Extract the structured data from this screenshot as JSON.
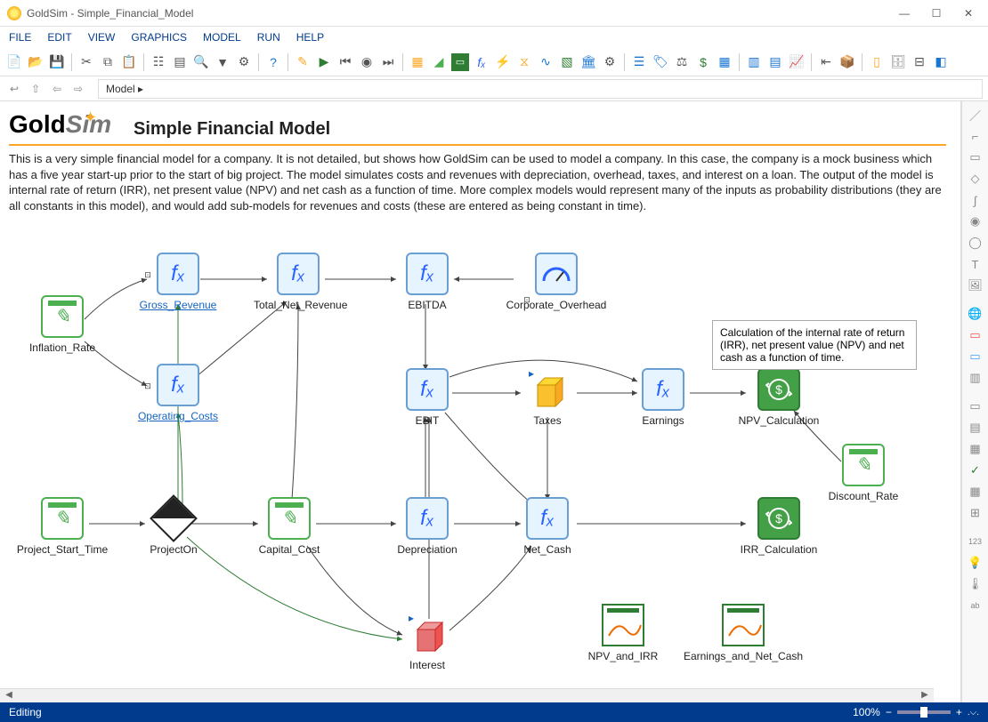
{
  "titlebar": {
    "text": "GoldSim  - Simple_Financial_Model"
  },
  "menu": [
    "FILE",
    "EDIT",
    "VIEW",
    "GRAPHICS",
    "MODEL",
    "RUN",
    "HELP"
  ],
  "breadcrumb": "Model  ▸",
  "page": {
    "logo_gold": "Gold",
    "logo_sim": "Sim",
    "title": "Simple Financial Model",
    "description": "This is a very simple financial model for a company. It is not detailed, but shows how GoldSim can be used to model a company. In this case, the company is a mock business which has a five year start-up prior to the start of big project. The model simulates costs and revenues with depreciation, overhead, taxes, and interest on a loan. The output of the model is internal rate of return (IRR), net present value (NPV) and net cash as a function of time. More complex models would represent many of the inputs as probability distributions (they are all constants in this model), and would add sub-models for revenues and costs (these are entered as being constant in time)."
  },
  "annotation": "Calculation of the internal rate of return (IRR), net present value (NPV) and net cash as a function of time.",
  "nodes": {
    "inflation_rate": "Inflation_Rate",
    "gross_revenue": "Gross_Revenue",
    "total_net_revenue": "Total_Net_Revenue",
    "ebitda": "EBITDA",
    "corporate_overhead": "Corporate_Overhead",
    "operating_costs": "Operating_Costs",
    "ebit": "EBIT",
    "taxes": "Taxes",
    "earnings": "Earnings",
    "npv_calculation": "NPV_Calculation",
    "project_start_time": "Project_Start_Time",
    "project_on": "ProjectOn",
    "capital_cost": "Capital_Cost",
    "depreciation": "Depreciation",
    "net_cash": "Net_Cash",
    "irr_calculation": "IRR_Calculation",
    "discount_rate": "Discount_Rate",
    "interest": "Interest",
    "npv_and_irr": "NPV_and_IRR",
    "earnings_and_net_cash": "Earnings_and_Net_Cash"
  },
  "status": {
    "mode": "Editing",
    "zoom": "100%"
  }
}
